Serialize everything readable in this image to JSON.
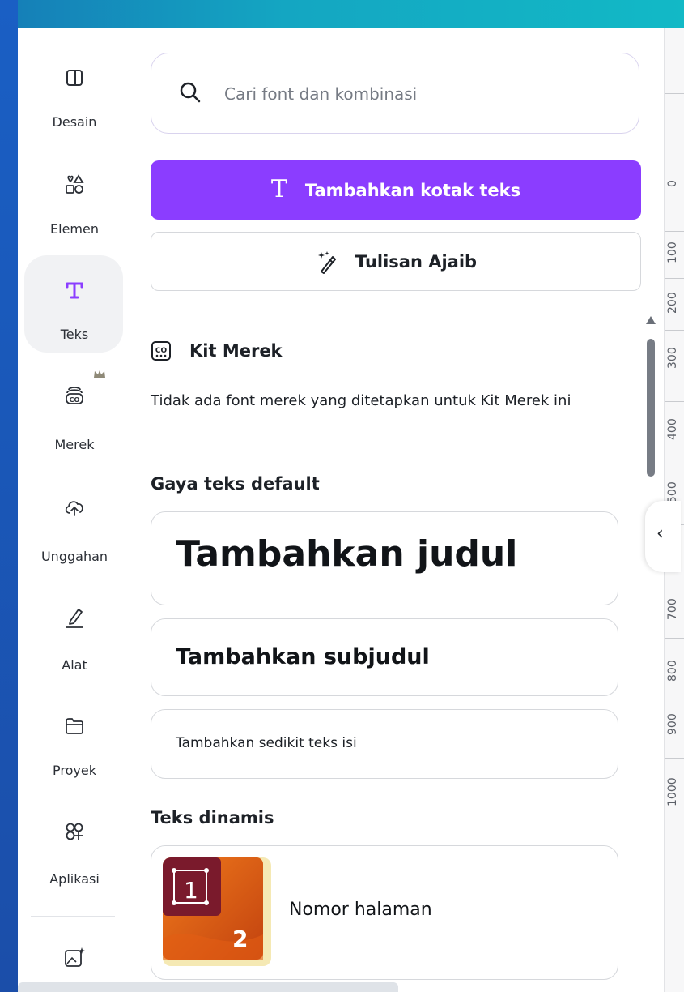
{
  "rail": {
    "items": [
      {
        "label": "Desain",
        "icon": "layout-icon"
      },
      {
        "label": "Elemen",
        "icon": "shapes-icon"
      },
      {
        "label": "Teks",
        "icon": "text-icon"
      },
      {
        "label": "Merek",
        "icon": "brand-icon"
      },
      {
        "label": "Unggahan",
        "icon": "cloud-upload-icon"
      },
      {
        "label": "Alat",
        "icon": "pen-icon"
      },
      {
        "label": "Proyek",
        "icon": "folder-icon"
      },
      {
        "label": "Aplikasi",
        "icon": "apps-icon"
      }
    ],
    "active": "Teks",
    "accent": "#8b3dff",
    "bottom_icon": "magic-media-icon"
  },
  "search": {
    "placeholder": "Cari font dan kombinasi"
  },
  "buttons": {
    "add_text_box": "Tambahkan kotak teks",
    "magic_write": "Tulisan Ajaib"
  },
  "brand_kit": {
    "title": "Kit Merek",
    "description": "Tidak ada font merek yang ditetapkan untuk Kit Merek ini"
  },
  "default_styles": {
    "title": "Gaya teks default",
    "heading": "Tambahkan judul",
    "subheading": "Tambahkan subjudul",
    "body": "Tambahkan sedikit teks isi"
  },
  "dynamic_text": {
    "title": "Teks dinamis",
    "page_number_label": "Nomor halaman",
    "thumb_numbers": [
      "1",
      "2"
    ]
  },
  "ruler": {
    "labels": [
      "0",
      "100",
      "200",
      "300",
      "400",
      "500",
      "700",
      "800",
      "900",
      "1000"
    ]
  }
}
